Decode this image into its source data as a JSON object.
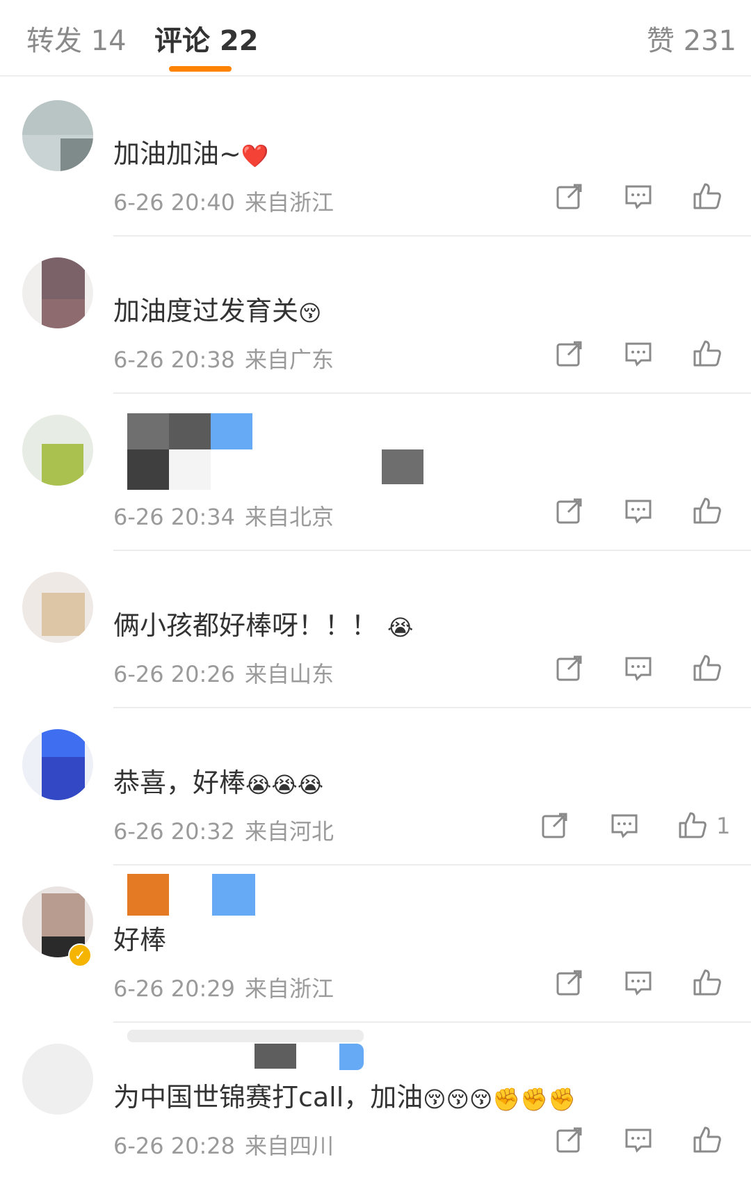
{
  "tabs": {
    "repost": "转发 14",
    "comments": "评论 22",
    "likes": "赞 231"
  },
  "comments": [
    {
      "text": "加油加油~",
      "emoji": "❤️",
      "time": "6-26 20:40",
      "location": "来自浙江",
      "like_count": ""
    },
    {
      "text": "加油度过发育关",
      "emoji": "😚",
      "time": "6-26 20:38",
      "location": "来自广东",
      "like_count": ""
    },
    {
      "text": "",
      "emoji": "",
      "time": "6-26 20:34",
      "location": "来自北京",
      "like_count": ""
    },
    {
      "text": "俩小孩都好棒呀！！！",
      "emoji": "😭",
      "time": "6-26 20:26",
      "location": "来自山东",
      "like_count": ""
    },
    {
      "text": "恭喜，好棒",
      "emoji": "😭😭😭",
      "time": "6-26 20:32",
      "location": "来自河北",
      "like_count": "1"
    },
    {
      "text": "好棒",
      "emoji": "",
      "time": "6-26 20:29",
      "location": "来自浙江",
      "like_count": ""
    },
    {
      "text": "为中国世锦赛打call，加油",
      "emoji": "😚😚😚✊✊✊",
      "time": "6-26 20:28",
      "location": "来自四川",
      "like_count": ""
    }
  ],
  "icons": {
    "share": "share-icon",
    "reply": "comment-icon",
    "like": "thumbs-up-icon"
  },
  "colors": {
    "accent": "#ff8200",
    "meta_text": "#9a9a9a",
    "divider": "#ececec"
  }
}
